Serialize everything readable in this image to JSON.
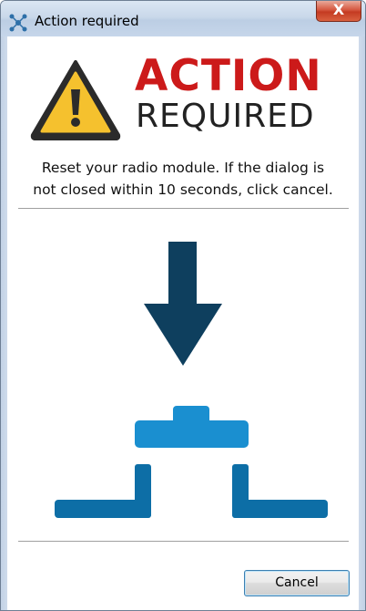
{
  "window": {
    "title": "Action required",
    "close_label": "X"
  },
  "header": {
    "action_word": "ACTION",
    "required_word": "REQUIRED",
    "warning_icon": "warning-triangle-icon",
    "action_color": "#cc1a1a"
  },
  "message": {
    "line1": "Reset your radio module. If the dialog is",
    "line2": "not closed within 10 seconds, click cancel."
  },
  "illustration": {
    "arrow_icon": "arrow-down-icon",
    "module_icon": "radio-module-icon",
    "arrow_color": "#0e3f5e",
    "button_color": "#1a8fd0",
    "base_color": "#0d6ea6"
  },
  "footer": {
    "cancel_label": "Cancel"
  }
}
